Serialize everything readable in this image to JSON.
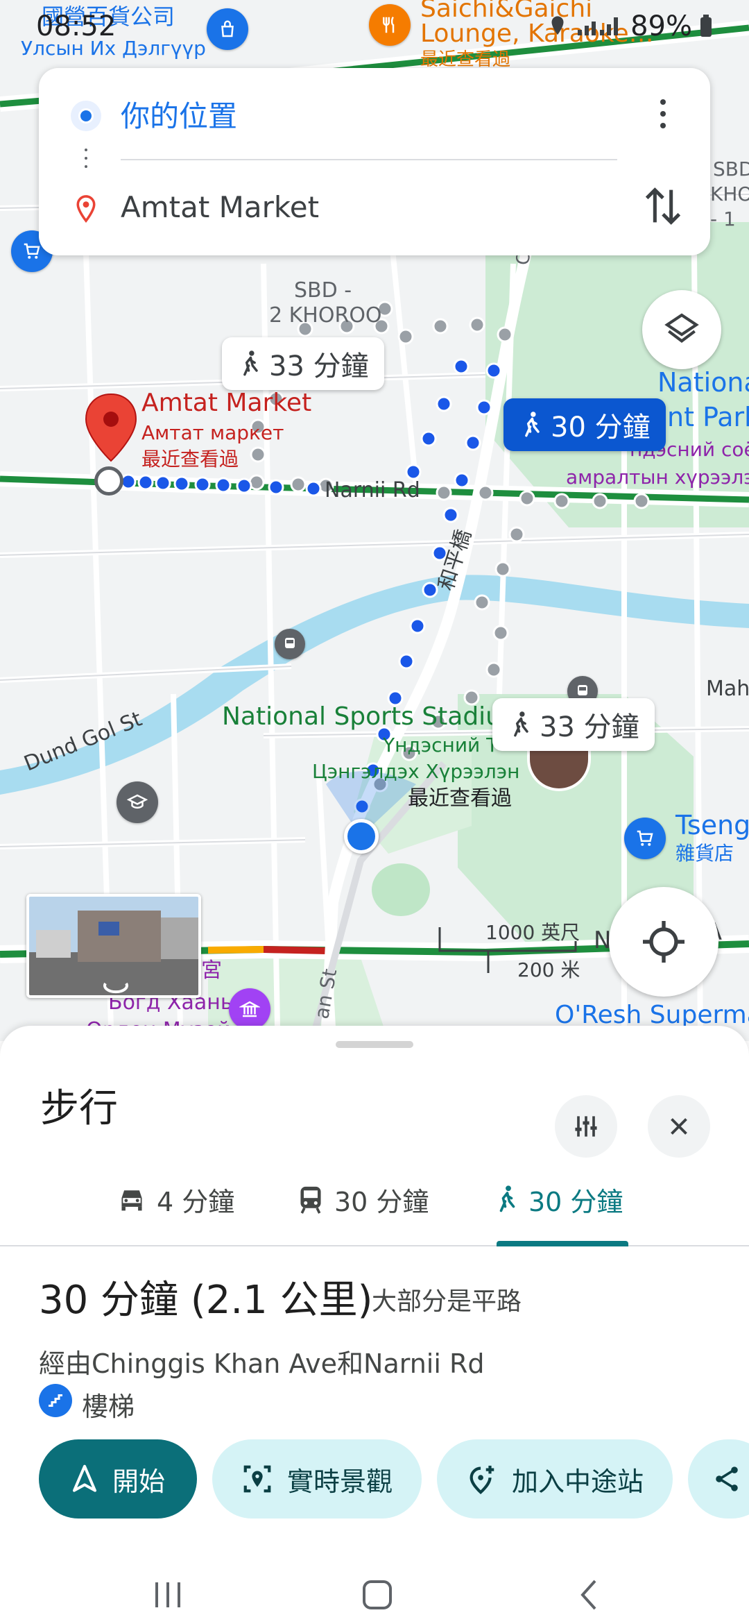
{
  "status_bar": {
    "time": "08:52",
    "battery": "89%"
  },
  "route_card": {
    "origin": "你的位置",
    "destination": "Amtat Market"
  },
  "map": {
    "labels": {
      "store_top": "國營百貨公司",
      "store_top_mn": "Улсын Их Дэлгүүр",
      "lounge": "Saichi&Gaichi",
      "lounge2": "Lounge, Karaoke…",
      "lounge_recent": "最近查看過",
      "sbd_top_right": "SBD",
      "sbd_top_right2": "KHO",
      "sbd_top_right3": "- 1",
      "sbd_center": "SBD -",
      "khoroo": "2 KHOROO",
      "dest_name": "Amtat Market",
      "dest_name_mn": "Амтат маркет",
      "dest_recent": "最近查看過",
      "national_park": "National",
      "national_park2": "nt Park",
      "park_mn": "ндэсний соёл",
      "park_mn2": "амралтын хүрээлэн",
      "narnii": "Narnii Rd",
      "heping": "和平橋",
      "dund_gol": "Dund Gol St",
      "stadium": "National Sports Stadiu",
      "stadium_mn": "Үндэсний Т",
      "stadium_mn2": "Цэнгэлдэх Хүрээлэн",
      "stadium_recent": "最近查看過",
      "maha": "Maha",
      "tseng": "Tseng",
      "tseng_sub": "雜貨店",
      "scale_ft": "1000 英尺",
      "scale_m": "200 米",
      "bogd": "Богд Хааны",
      "bogd2": "Ордон Музей",
      "palace": "宮",
      "oresh": "O'Resh Superma",
      "n_label": "N",
      "ee": "e A",
      "road_ch": "Ch",
      "road_san": "an St"
    },
    "route_pills": {
      "alt1": "33 分鐘",
      "selected": "30 分鐘",
      "alt2": "33 分鐘"
    }
  },
  "sheet": {
    "title": "步行",
    "tabs": [
      {
        "mode": "driving",
        "label": "4 分鐘"
      },
      {
        "mode": "transit",
        "label": "30 分鐘"
      },
      {
        "mode": "walking",
        "label": "30 分鐘"
      }
    ],
    "summary_time": "30 分鐘 (2.1 公里)",
    "summary_note": "大部分是平路",
    "via": "經由Chinggis Khan Ave和Narnii Rd",
    "stairs": "樓梯",
    "actions": {
      "start": "開始",
      "live_view": "實時景觀",
      "add_stop": "加入中途站"
    }
  },
  "colors": {
    "route_blue": "#1a57e8",
    "alt_route_grey": "#9aa0a6",
    "accent_teal": "#0b6f79",
    "road_green": "#1e8e3e",
    "park_green": "#cdebd4",
    "river_blue": "#a8dcf0",
    "dest_red": "#ea4335"
  }
}
